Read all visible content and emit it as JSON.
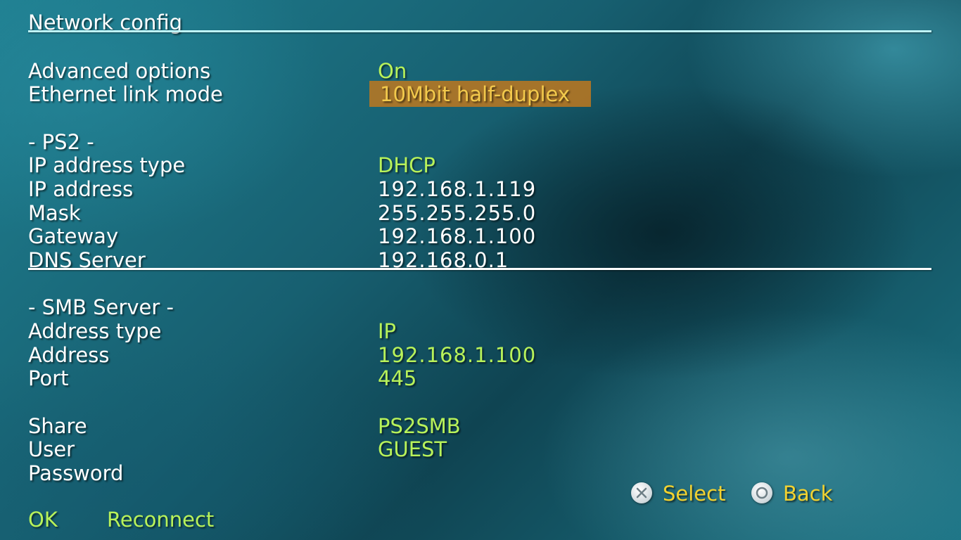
{
  "title": "Network config",
  "advanced": {
    "advanced_options": {
      "label": "Advanced options",
      "value": "On"
    },
    "ethernet_link_mode": {
      "label": "Ethernet link mode",
      "value": "10Mbit half-duplex"
    }
  },
  "ps2": {
    "header": "- PS2 -",
    "ip_address_type": {
      "label": "IP address type",
      "value": "DHCP"
    },
    "ip_address": {
      "label": "IP address",
      "value": "192.168.1.119"
    },
    "mask": {
      "label": "Mask",
      "value": "255.255.255.0"
    },
    "gateway": {
      "label": "Gateway",
      "value": "192.168.1.100"
    },
    "dns_server": {
      "label": "DNS Server",
      "value": "192.168.0.1"
    }
  },
  "smb": {
    "header": "- SMB Server -",
    "address_type": {
      "label": "Address type",
      "value": "IP"
    },
    "address": {
      "label": "Address",
      "value": "192.168.1.100"
    },
    "port": {
      "label": "Port",
      "value": "445"
    },
    "share": {
      "label": "Share",
      "value": "PS2SMB"
    },
    "user": {
      "label": "User",
      "value": "GUEST"
    },
    "password": {
      "label": "Password",
      "value": ""
    }
  },
  "actions": {
    "ok": "OK",
    "reconnect": "Reconnect"
  },
  "hints": {
    "select": {
      "icon": "cross-button-icon",
      "label": "Select"
    },
    "back": {
      "icon": "circle-button-icon",
      "label": "Back"
    }
  },
  "colors": {
    "value_green": "#b8f25a",
    "highlight_orange": "#be781e",
    "hint_yellow": "#f2d230"
  }
}
